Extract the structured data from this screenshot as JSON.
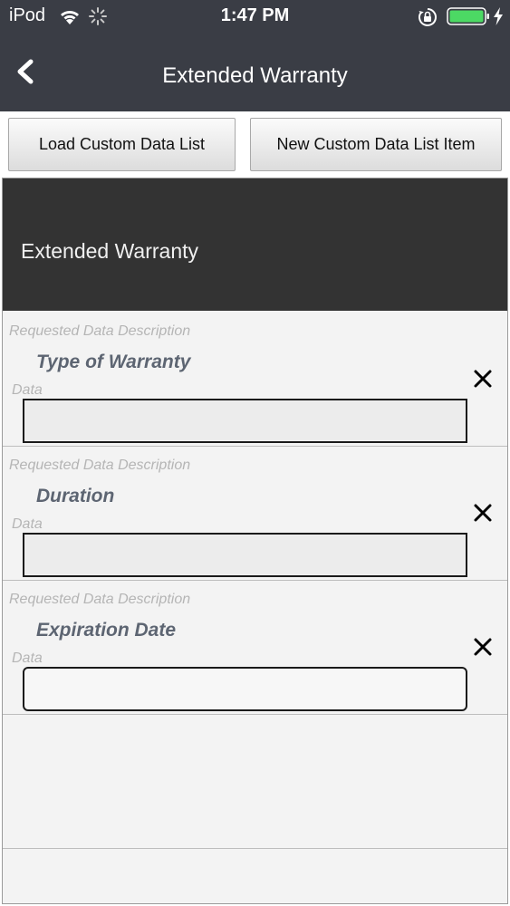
{
  "status_bar": {
    "device": "iPod",
    "time": "1:47 PM",
    "icons": [
      "wifi-icon",
      "activity-spinner-icon",
      "orientation-lock-icon",
      "battery-icon",
      "charging-bolt-icon"
    ]
  },
  "nav": {
    "title": "Extended Warranty",
    "back_icon": "chevron-left-icon"
  },
  "toolbar": {
    "load_label": "Load Custom Data List",
    "new_label": "New Custom Data List Item"
  },
  "panel": {
    "title": "Extended Warranty"
  },
  "items": [
    {
      "desc_label": "Requested Data Description",
      "name": "Type of Warranty",
      "data_label": "Data",
      "value": ""
    },
    {
      "desc_label": "Requested Data Description",
      "name": "Duration",
      "data_label": "Data",
      "value": ""
    },
    {
      "desc_label": "Requested Data Description",
      "name": "Expiration Date",
      "data_label": "Data",
      "value": ""
    }
  ],
  "colors": {
    "bar_background": "#3a3d45",
    "panel_header": "#333333",
    "item_name": "#5d6572",
    "battery": "#4cd964"
  }
}
